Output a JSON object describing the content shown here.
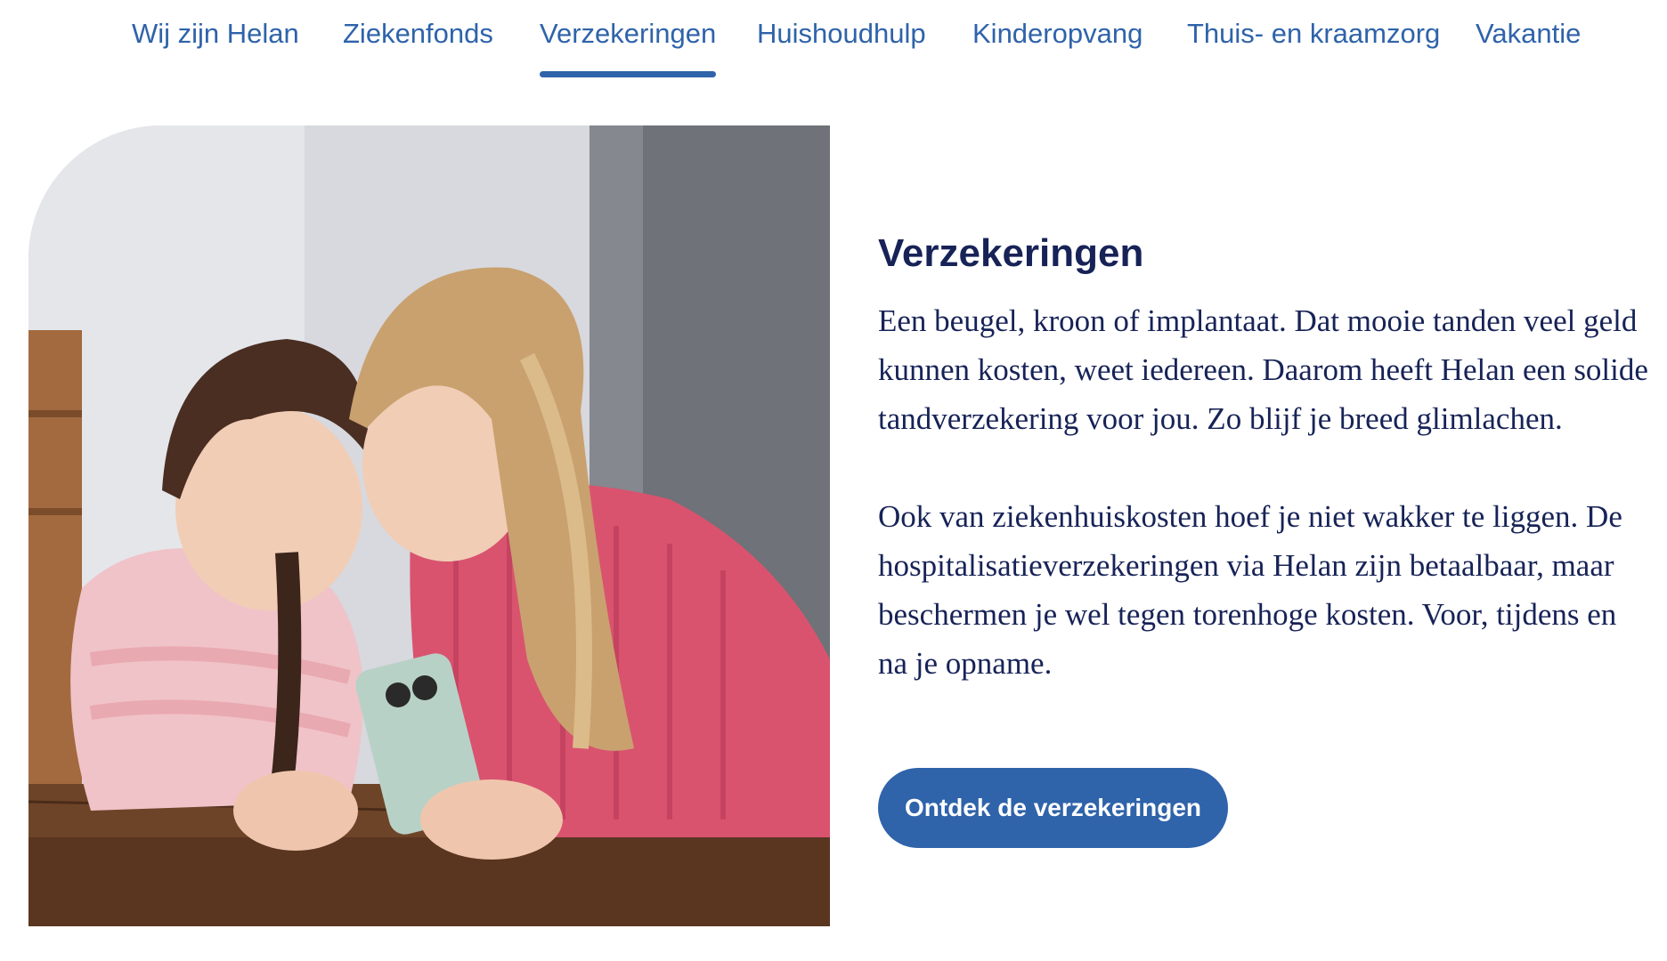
{
  "nav": {
    "items": [
      {
        "label": "Wij zijn Helan"
      },
      {
        "label": "Ziekenfonds"
      },
      {
        "label": "Verzekeringen",
        "active": true
      },
      {
        "label": "Huishoudhulp"
      },
      {
        "label": "Kinderopvang"
      },
      {
        "label": "Thuis- en kraamzorg"
      },
      {
        "label": "Vakantie"
      }
    ]
  },
  "hero": {
    "image_subject": "Two girls lying on a wooden floor, smiling and looking at a smartphone together"
  },
  "section": {
    "title": "Verzekeringen",
    "paragraph_1": "Een beugel, kroon of implantaat. Dat mooie tanden veel geld kunnen kosten, weet iedereen. Daarom heeft Helan een solide tandverzekering voor jou. Zo blijf je breed glimlachen.",
    "paragraph_2": "Ook van ziekenhuiskosten hoef je niet wakker te liggen. De hospitalisatieverzekeringen via Helan zijn betaalbaar, maar beschermen je wel tegen torenhoge kosten. Voor, tijdens en na je opname.",
    "cta_label": "Ontdek de verzekeringen"
  },
  "colors": {
    "brand_blue": "#2f63aa",
    "heading_navy": "#172357",
    "background": "#ffffff"
  }
}
